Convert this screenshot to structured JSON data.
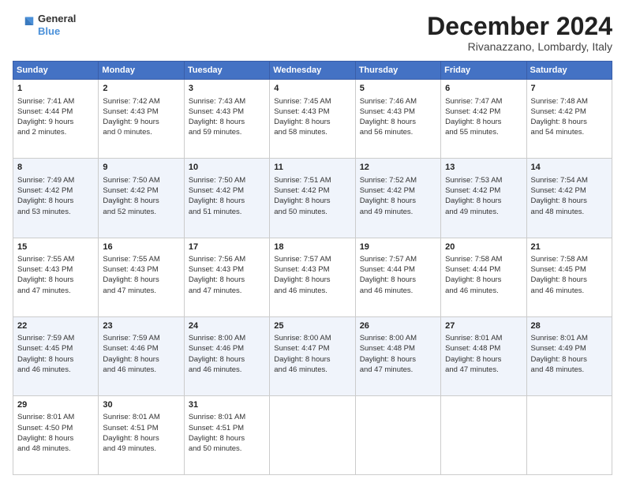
{
  "logo": {
    "line1": "General",
    "line2": "Blue"
  },
  "title": "December 2024",
  "subtitle": "Rivanazzano, Lombardy, Italy",
  "headers": [
    "Sunday",
    "Monday",
    "Tuesday",
    "Wednesday",
    "Thursday",
    "Friday",
    "Saturday"
  ],
  "weeks": [
    [
      {
        "day": "1",
        "lines": [
          "Sunrise: 7:41 AM",
          "Sunset: 4:44 PM",
          "Daylight: 9 hours",
          "and 2 minutes."
        ]
      },
      {
        "day": "2",
        "lines": [
          "Sunrise: 7:42 AM",
          "Sunset: 4:43 PM",
          "Daylight: 9 hours",
          "and 0 minutes."
        ]
      },
      {
        "day": "3",
        "lines": [
          "Sunrise: 7:43 AM",
          "Sunset: 4:43 PM",
          "Daylight: 8 hours",
          "and 59 minutes."
        ]
      },
      {
        "day": "4",
        "lines": [
          "Sunrise: 7:45 AM",
          "Sunset: 4:43 PM",
          "Daylight: 8 hours",
          "and 58 minutes."
        ]
      },
      {
        "day": "5",
        "lines": [
          "Sunrise: 7:46 AM",
          "Sunset: 4:43 PM",
          "Daylight: 8 hours",
          "and 56 minutes."
        ]
      },
      {
        "day": "6",
        "lines": [
          "Sunrise: 7:47 AM",
          "Sunset: 4:42 PM",
          "Daylight: 8 hours",
          "and 55 minutes."
        ]
      },
      {
        "day": "7",
        "lines": [
          "Sunrise: 7:48 AM",
          "Sunset: 4:42 PM",
          "Daylight: 8 hours",
          "and 54 minutes."
        ]
      }
    ],
    [
      {
        "day": "8",
        "lines": [
          "Sunrise: 7:49 AM",
          "Sunset: 4:42 PM",
          "Daylight: 8 hours",
          "and 53 minutes."
        ]
      },
      {
        "day": "9",
        "lines": [
          "Sunrise: 7:50 AM",
          "Sunset: 4:42 PM",
          "Daylight: 8 hours",
          "and 52 minutes."
        ]
      },
      {
        "day": "10",
        "lines": [
          "Sunrise: 7:50 AM",
          "Sunset: 4:42 PM",
          "Daylight: 8 hours",
          "and 51 minutes."
        ]
      },
      {
        "day": "11",
        "lines": [
          "Sunrise: 7:51 AM",
          "Sunset: 4:42 PM",
          "Daylight: 8 hours",
          "and 50 minutes."
        ]
      },
      {
        "day": "12",
        "lines": [
          "Sunrise: 7:52 AM",
          "Sunset: 4:42 PM",
          "Daylight: 8 hours",
          "and 49 minutes."
        ]
      },
      {
        "day": "13",
        "lines": [
          "Sunrise: 7:53 AM",
          "Sunset: 4:42 PM",
          "Daylight: 8 hours",
          "and 49 minutes."
        ]
      },
      {
        "day": "14",
        "lines": [
          "Sunrise: 7:54 AM",
          "Sunset: 4:42 PM",
          "Daylight: 8 hours",
          "and 48 minutes."
        ]
      }
    ],
    [
      {
        "day": "15",
        "lines": [
          "Sunrise: 7:55 AM",
          "Sunset: 4:43 PM",
          "Daylight: 8 hours",
          "and 47 minutes."
        ]
      },
      {
        "day": "16",
        "lines": [
          "Sunrise: 7:55 AM",
          "Sunset: 4:43 PM",
          "Daylight: 8 hours",
          "and 47 minutes."
        ]
      },
      {
        "day": "17",
        "lines": [
          "Sunrise: 7:56 AM",
          "Sunset: 4:43 PM",
          "Daylight: 8 hours",
          "and 47 minutes."
        ]
      },
      {
        "day": "18",
        "lines": [
          "Sunrise: 7:57 AM",
          "Sunset: 4:43 PM",
          "Daylight: 8 hours",
          "and 46 minutes."
        ]
      },
      {
        "day": "19",
        "lines": [
          "Sunrise: 7:57 AM",
          "Sunset: 4:44 PM",
          "Daylight: 8 hours",
          "and 46 minutes."
        ]
      },
      {
        "day": "20",
        "lines": [
          "Sunrise: 7:58 AM",
          "Sunset: 4:44 PM",
          "Daylight: 8 hours",
          "and 46 minutes."
        ]
      },
      {
        "day": "21",
        "lines": [
          "Sunrise: 7:58 AM",
          "Sunset: 4:45 PM",
          "Daylight: 8 hours",
          "and 46 minutes."
        ]
      }
    ],
    [
      {
        "day": "22",
        "lines": [
          "Sunrise: 7:59 AM",
          "Sunset: 4:45 PM",
          "Daylight: 8 hours",
          "and 46 minutes."
        ]
      },
      {
        "day": "23",
        "lines": [
          "Sunrise: 7:59 AM",
          "Sunset: 4:46 PM",
          "Daylight: 8 hours",
          "and 46 minutes."
        ]
      },
      {
        "day": "24",
        "lines": [
          "Sunrise: 8:00 AM",
          "Sunset: 4:46 PM",
          "Daylight: 8 hours",
          "and 46 minutes."
        ]
      },
      {
        "day": "25",
        "lines": [
          "Sunrise: 8:00 AM",
          "Sunset: 4:47 PM",
          "Daylight: 8 hours",
          "and 46 minutes."
        ]
      },
      {
        "day": "26",
        "lines": [
          "Sunrise: 8:00 AM",
          "Sunset: 4:48 PM",
          "Daylight: 8 hours",
          "and 47 minutes."
        ]
      },
      {
        "day": "27",
        "lines": [
          "Sunrise: 8:01 AM",
          "Sunset: 4:48 PM",
          "Daylight: 8 hours",
          "and 47 minutes."
        ]
      },
      {
        "day": "28",
        "lines": [
          "Sunrise: 8:01 AM",
          "Sunset: 4:49 PM",
          "Daylight: 8 hours",
          "and 48 minutes."
        ]
      }
    ],
    [
      {
        "day": "29",
        "lines": [
          "Sunrise: 8:01 AM",
          "Sunset: 4:50 PM",
          "Daylight: 8 hours",
          "and 48 minutes."
        ]
      },
      {
        "day": "30",
        "lines": [
          "Sunrise: 8:01 AM",
          "Sunset: 4:51 PM",
          "Daylight: 8 hours",
          "and 49 minutes."
        ]
      },
      {
        "day": "31",
        "lines": [
          "Sunrise: 8:01 AM",
          "Sunset: 4:51 PM",
          "Daylight: 8 hours",
          "and 50 minutes."
        ]
      },
      null,
      null,
      null,
      null
    ]
  ]
}
